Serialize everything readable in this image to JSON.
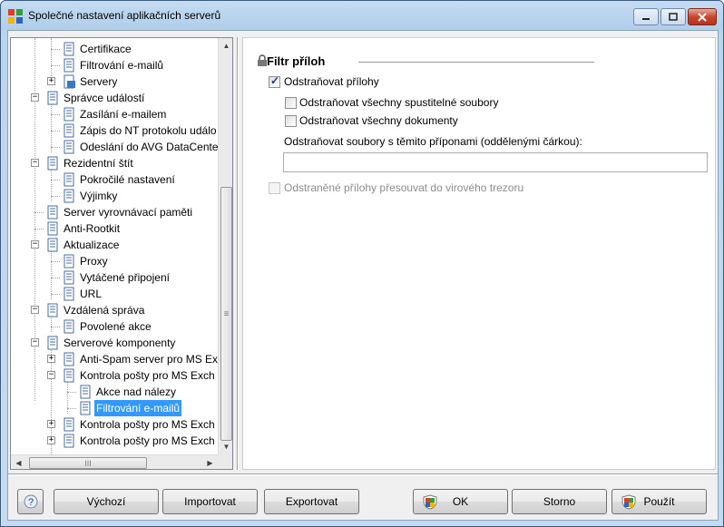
{
  "window": {
    "title": "Společné nastavení aplikačních serverů"
  },
  "tree": {
    "items": [
      {
        "label": "Certifikace"
      },
      {
        "label": "Filtrování e-mailů"
      },
      {
        "label": "Servery"
      },
      {
        "label": "Správce událostí"
      },
      {
        "label": "Zasílání e-mailem"
      },
      {
        "label": "Zápis do NT protokolu událo"
      },
      {
        "label": "Odeslání do AVG DataCente"
      },
      {
        "label": "Rezidentní štít"
      },
      {
        "label": "Pokročilé nastavení"
      },
      {
        "label": "Výjimky"
      },
      {
        "label": "Server vyrovnávací paměti"
      },
      {
        "label": "Anti-Rootkit"
      },
      {
        "label": "Aktualizace"
      },
      {
        "label": "Proxy"
      },
      {
        "label": "Vytáčené připojení"
      },
      {
        "label": "URL"
      },
      {
        "label": "Vzdálená správa"
      },
      {
        "label": "Povolené akce"
      },
      {
        "label": "Serverové komponenty"
      },
      {
        "label": "Anti-Spam server pro MS Ex"
      },
      {
        "label": "Kontrola pošty pro MS Exch"
      },
      {
        "label": "Akce nad nálezy"
      },
      {
        "label": "Filtrování e-mailů"
      },
      {
        "label": "Kontrola pošty pro MS Exch"
      },
      {
        "label": "Kontrola pošty pro MS Exch"
      }
    ]
  },
  "panel": {
    "group_title": "Filtr příloh",
    "remove_attachments": {
      "label": "Odstraňovat přílohy",
      "checked": true
    },
    "remove_executables": {
      "label": "Odstraňovat všechny spustitelné soubory",
      "checked": false
    },
    "remove_documents": {
      "label": "Odstraňovat všechny dokumenty",
      "checked": false
    },
    "extensions_label": "Odstraňovat soubory s těmito příponami (oddělenými čárkou):",
    "extensions_value": "",
    "move_to_vault": {
      "label": "Odstraněné přílohy přesouvat do virového trezoru",
      "checked": false,
      "disabled": true
    }
  },
  "buttons": {
    "help": "?",
    "default": "Výchozí",
    "import": "Importovat",
    "export": "Exportovat",
    "ok": "OK",
    "cancel": "Storno",
    "apply": "Použít"
  }
}
